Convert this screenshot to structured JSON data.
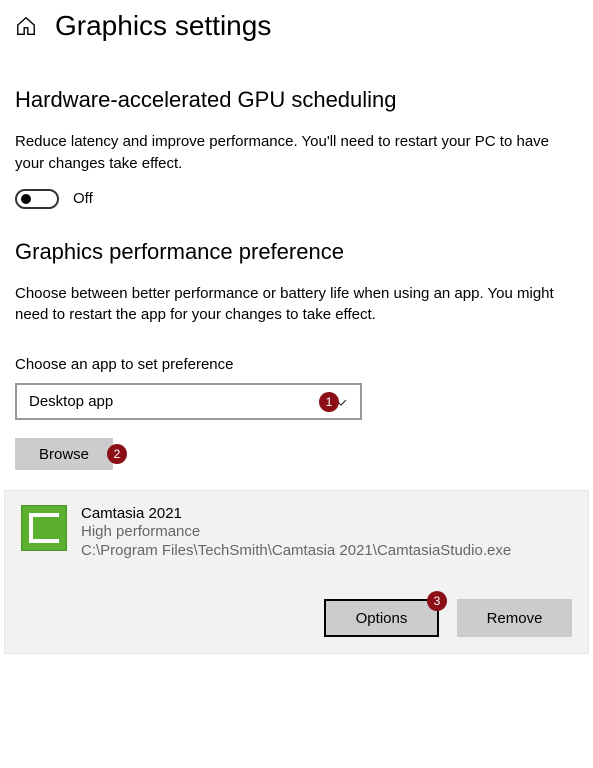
{
  "page": {
    "title": "Graphics settings"
  },
  "gpu": {
    "heading": "Hardware-accelerated GPU scheduling",
    "description": "Reduce latency and improve performance. You'll need to restart your PC to have your changes take effect.",
    "toggle_state": "Off"
  },
  "perf": {
    "heading": "Graphics performance preference",
    "description": "Choose between better performance or battery life when using an app. You might need to restart the app for your changes to take effect.",
    "choose_label": "Choose an app to set preference",
    "select_value": "Desktop app",
    "browse_label": "Browse"
  },
  "app": {
    "name": "Camtasia 2021",
    "performance": "High performance",
    "path": "C:\\Program Files\\TechSmith\\Camtasia 2021\\CamtasiaStudio.exe",
    "options_label": "Options",
    "remove_label": "Remove"
  },
  "annotations": {
    "badge1": "1",
    "badge2": "2",
    "badge3": "3"
  }
}
